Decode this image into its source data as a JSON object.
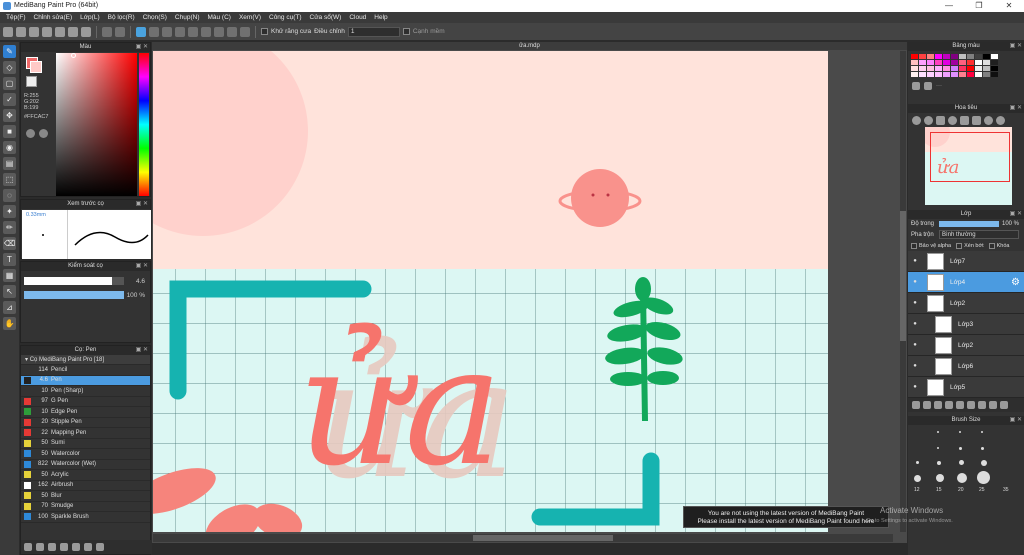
{
  "window": {
    "title": "MediBang Paint Pro (64bit)",
    "minimize": "—",
    "maximize": "❐",
    "close": "✕"
  },
  "menu": [
    "Tệp(F)",
    "Chỉnh sửa(E)",
    "Lớp(L)",
    "Bộ lọc(R)",
    "Chọn(S)",
    "Chụp(N)",
    "Màu (C)",
    "Xem(V)",
    "Công cụ(T)",
    "Cửa sổ(W)",
    "Cloud",
    "Help"
  ],
  "toolbar": {
    "antialias_label": "Khử răng cưa",
    "adjust_label": "Điều chỉnh",
    "adjust_value": "1",
    "edge_label": "Cạnh mềm"
  },
  "color_panel": {
    "title": "Màu",
    "rgb": {
      "r": "R:255",
      "g": "G:202",
      "b": "B:199"
    },
    "hex": "#FFCAC7",
    "fg_color": "#ffcac7"
  },
  "brush_preview": {
    "title": "Xem trước cọ",
    "size": "0.33mm"
  },
  "brush_control": {
    "title": "Kiểm soát cọ",
    "size_value": "4.6",
    "opacity_value": "100 %",
    "size_fill": 0.88,
    "opacity_fill": 1.0
  },
  "brush_panel": {
    "title": "Cọ: Pen",
    "group": "Cọ MediBang Paint Pro [18]",
    "items": [
      {
        "size": "114",
        "name": "Pencil",
        "color": "#333333"
      },
      {
        "size": "4.6",
        "name": "Pen",
        "color": "#222222",
        "selected": true
      },
      {
        "size": "10",
        "name": "Pen (Sharp)",
        "color": "#333333"
      },
      {
        "size": "97",
        "name": "G Pen",
        "color": "#e53935"
      },
      {
        "size": "10",
        "name": "Edge Pen",
        "color": "#2e9e3a"
      },
      {
        "size": "20",
        "name": "Stipple Pen",
        "color": "#e53935"
      },
      {
        "size": "22",
        "name": "Mapping Pen",
        "color": "#e53935"
      },
      {
        "size": "50",
        "name": "Sumi",
        "color": "#e6d23a"
      },
      {
        "size": "50",
        "name": "Watercolor",
        "color": "#2e89d8"
      },
      {
        "size": "822",
        "name": "Watercolor (Wet)",
        "color": "#2e89d8"
      },
      {
        "size": "50",
        "name": "Acrylic",
        "color": "#e6d23a"
      },
      {
        "size": "162",
        "name": "Airbrush",
        "color": "#ffffff"
      },
      {
        "size": "50",
        "name": "Blur",
        "color": "#e6d23a"
      },
      {
        "size": "70",
        "name": "Smudge",
        "color": "#e6d23a"
      },
      {
        "size": "100",
        "name": "Sparkle Brush",
        "color": "#2e89d8"
      }
    ]
  },
  "document": {
    "tab": "ửa.mdp",
    "text": "ửa"
  },
  "palette_panel": {
    "title": "Bảng màu",
    "more": "···"
  },
  "navigator": {
    "title": "Hoa tiêu"
  },
  "layer_panel": {
    "title": "Lớp",
    "opacity_label": "Độ trong",
    "opacity_value": "100 %",
    "opacity_fill": 1.0,
    "blend_label": "Pha trộn",
    "blend_value": "Bình thường",
    "protect_alpha": "Bảo vệ alpha",
    "clip": "Xén bớt",
    "lock": "Khóa",
    "layers": [
      {
        "name": "Lớp7",
        "selected": false,
        "indent": 0
      },
      {
        "name": "Lớp4",
        "selected": true,
        "indent": 0
      },
      {
        "name": "Lớp2",
        "selected": false,
        "indent": 0
      },
      {
        "name": "Lớp3",
        "selected": false,
        "indent": 1
      },
      {
        "name": "Lớp2",
        "selected": false,
        "indent": 1
      },
      {
        "name": "Lớp6",
        "selected": false,
        "indent": 1
      },
      {
        "name": "Lớp5",
        "selected": false,
        "indent": 0
      }
    ]
  },
  "brush_size_panel": {
    "title": "Brush Size",
    "labels": [
      "12",
      "15",
      "20",
      "25",
      "35"
    ]
  },
  "notification": {
    "line1": "You are not using the latest version of MediBang Paint",
    "line2": "Please install the latest version of MediBang Paint found here"
  },
  "watermark": {
    "title": "Activate Windows",
    "subtitle": "Go to Settings to activate Windows."
  },
  "palette_colors": [
    "#ff0000",
    "#ff4040",
    "#ff8080",
    "#ff00ff",
    "#c000c0",
    "#800080",
    "#c0c0c0",
    "#808080",
    "#404040",
    "#000000",
    "#ffffff",
    "#ffc0c0",
    "#ffa0ff",
    "#ff80ff",
    "#ff40c0",
    "#e000e0",
    "#a000a0",
    "#ff6080",
    "#ff3030",
    "#ffffff",
    "#e0e0e0",
    "#202020",
    "#ffe0e0",
    "#ffd0f0",
    "#ffc0e0",
    "#ffb0ff",
    "#ff90e0",
    "#d080ff",
    "#ff3060",
    "#ff0000",
    "#f0f0f0",
    "#c0c0c0",
    "#000000",
    "#fff0f0",
    "#ffe0ff",
    "#ffd0ff",
    "#ffc0ff",
    "#f0a0ff",
    "#e090ff",
    "#ff8090",
    "#ff0040",
    "#ffffff",
    "#808080",
    "#101010"
  ]
}
